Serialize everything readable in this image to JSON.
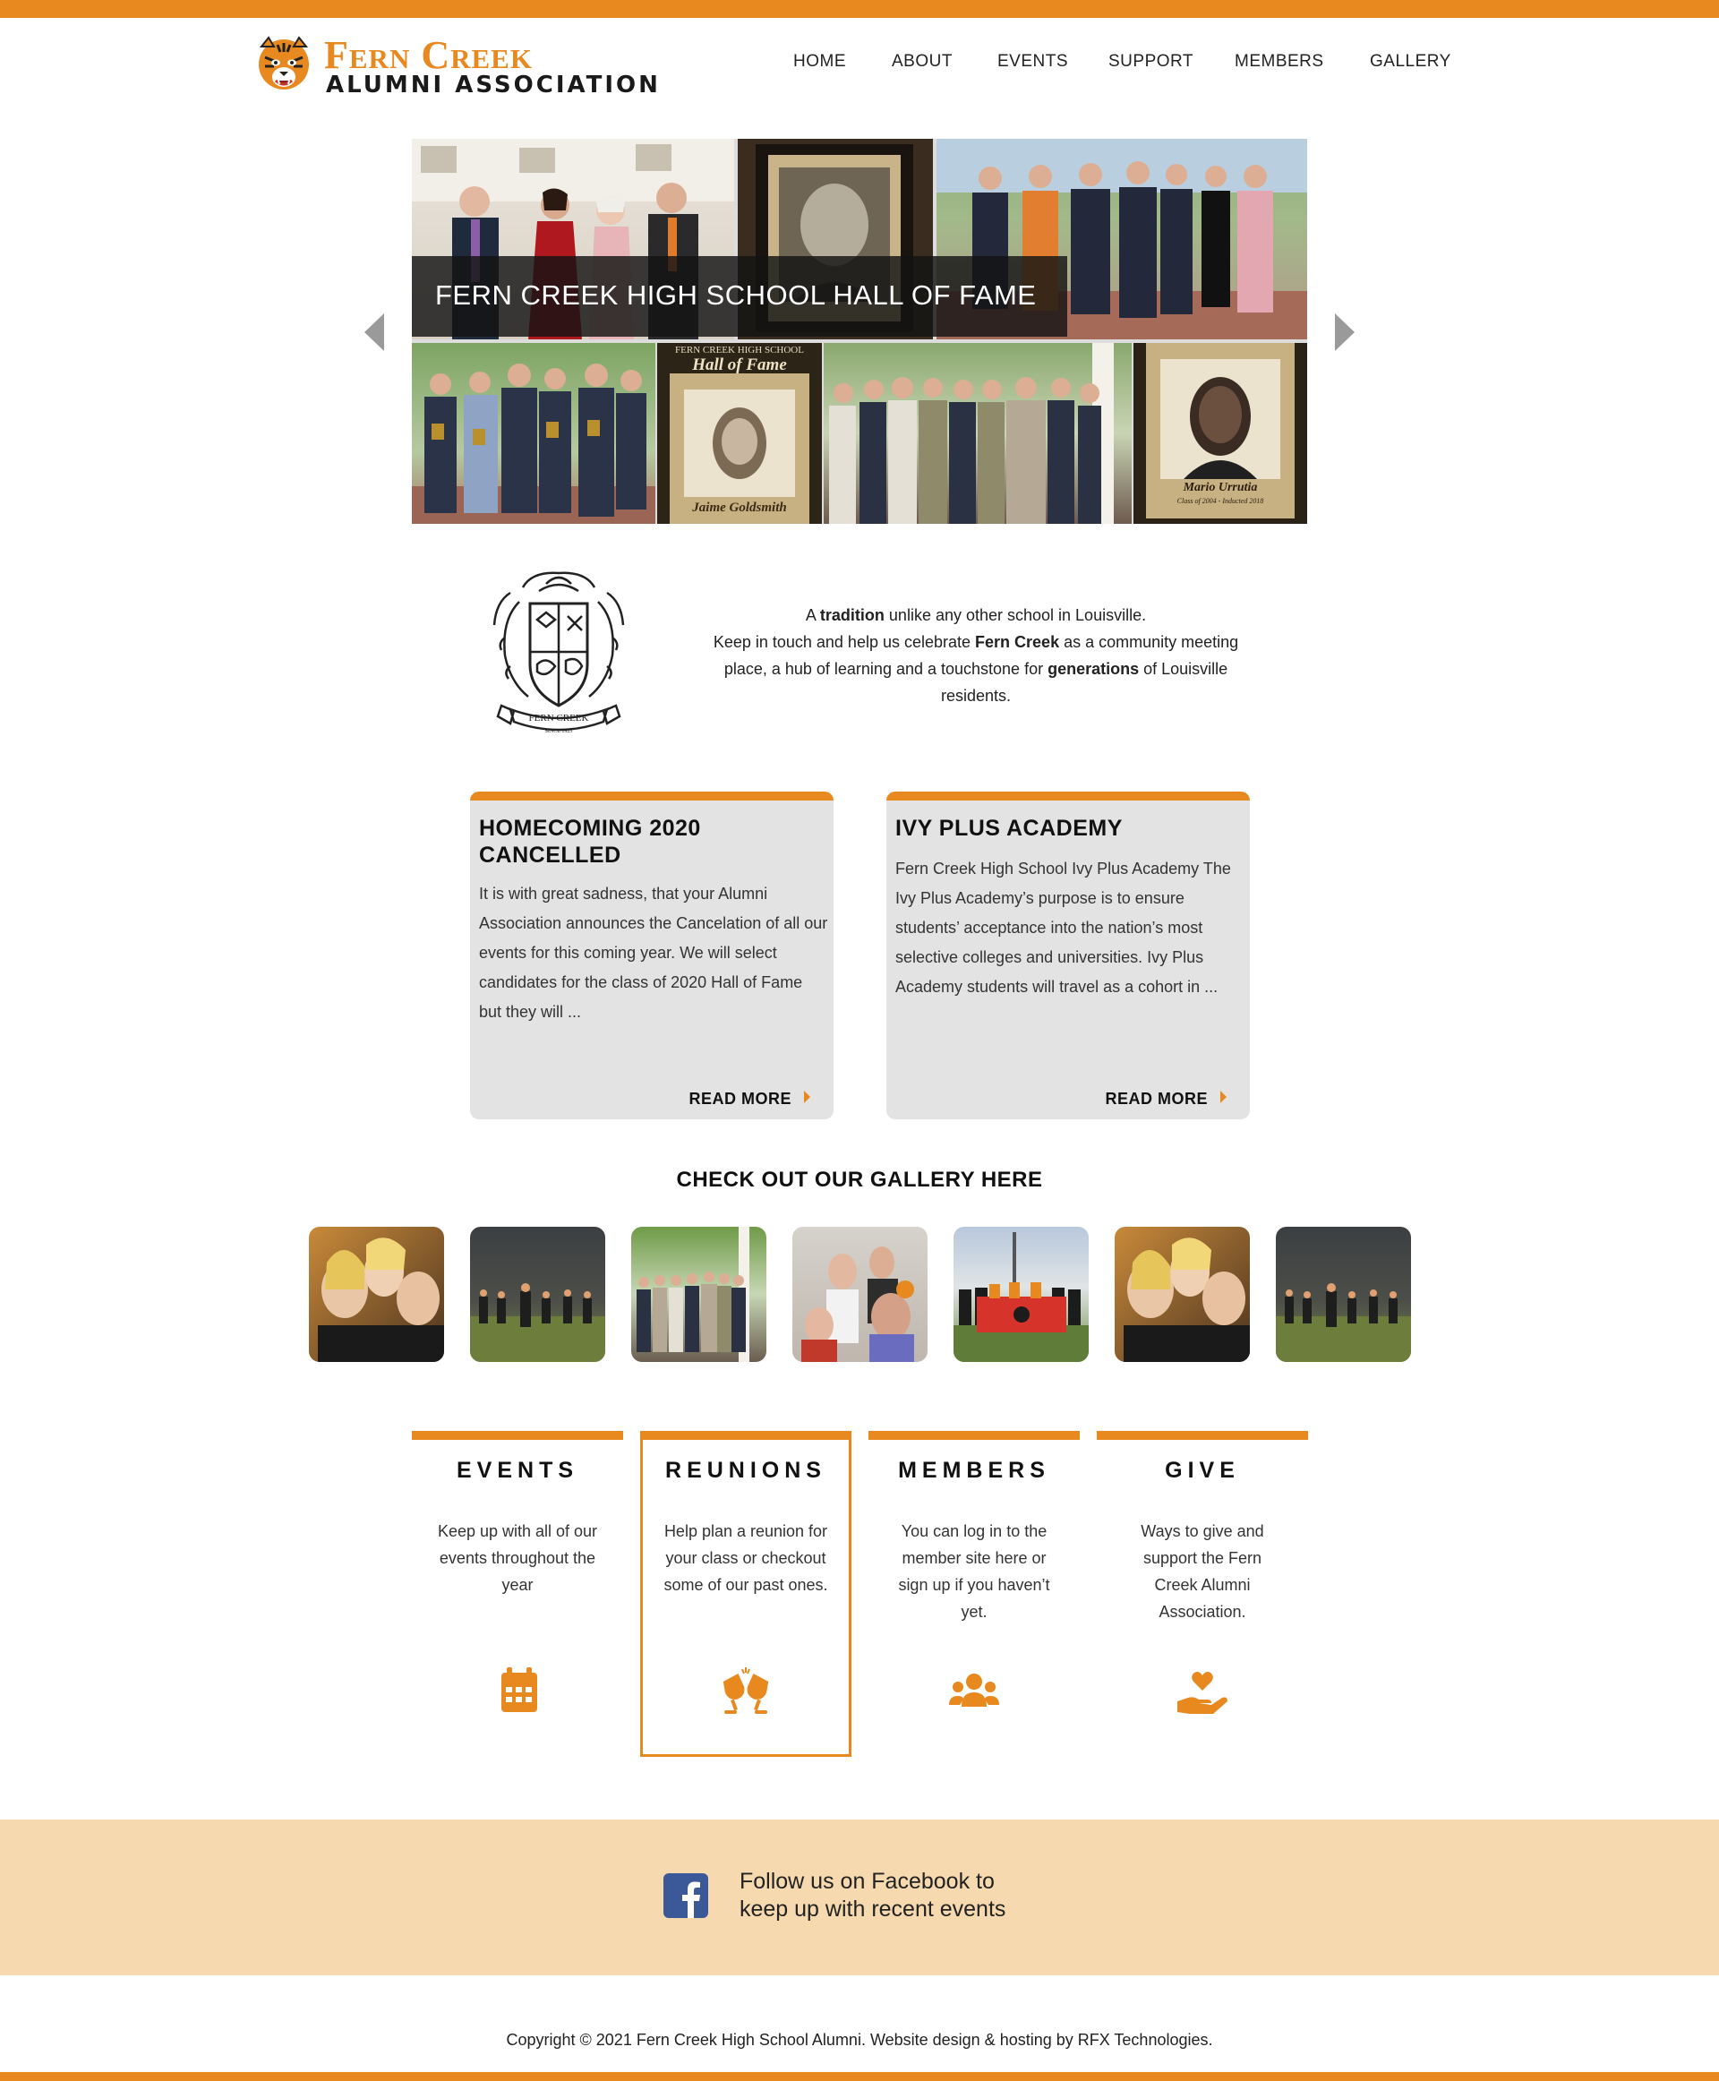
{
  "colors": {
    "accent": "#e8891f",
    "card_bg": "#e3e3e3",
    "band_bg": "#f6d9af",
    "facebook": "#3b5998"
  },
  "header": {
    "logo_line1": "Fern Creek",
    "logo_line2": "ALUMNI ASSOCIATION",
    "logo_icon": "tiger-head-icon",
    "nav": [
      "HOME",
      "ABOUT",
      "EVENTS",
      "SUPPORT",
      "MEMBERS",
      "GALLERY"
    ]
  },
  "slider": {
    "caption": "FERN CREEK HIGH SCHOOL HALL OF FAME",
    "plaque_texts": [
      "FERN CREEK HIGH SCHOOL",
      "Hall of Fame",
      "Jaime Goldsmith",
      "Mario Urrutia",
      "Class of 2004 - Inducted 2018"
    ]
  },
  "intro": {
    "crest_text": "FERN CREEK",
    "crest_since": "SINCE 1923",
    "line1_pre": "A ",
    "line1_bold": "tradition",
    "line1_post": " unlike any other school in Louisville.",
    "line2_pre": "Keep in touch and help us celebrate ",
    "line2_bold": "Fern Creek",
    "line2_post": " as a community meeting place, a hub of learning and a touchstone for ",
    "line3_bold": "generations",
    "line3_post": " of Louisville residents."
  },
  "news": [
    {
      "title": "HOMECOMING 2020 CANCELLED",
      "body": "It is with great sadness, that your Alumni Association announces the Cancelation of all our events for this coming year. We will select candidates for the class of 2020 Hall of Fame but they will ...",
      "link": "READ MORE"
    },
    {
      "title": "IVY PLUS ACADEMY",
      "body": "Fern Creek High School Ivy Plus Academy The Ivy Plus Academy’s purpose is to ensure students’ acceptance into the nation’s most selective colleges and universities. Ivy Plus Academy students will travel as a cohort in ...",
      "link": "READ MORE"
    }
  ],
  "gallery": {
    "title": "CHECK OUT OUR GALLERY HERE"
  },
  "features": [
    {
      "title": "EVENTS",
      "text": "Keep up with all of our events throughout the year",
      "icon": "calendar-icon"
    },
    {
      "title": "REUNIONS",
      "text": "Help plan a reunion for your class or checkout some of our past ones.",
      "icon": "cheers-glasses-icon"
    },
    {
      "title": "MEMBERS",
      "text": "You can log in to the member site here or sign up if you haven’t yet.",
      "icon": "group-users-icon"
    },
    {
      "title": "GIVE",
      "text": "Ways to give and support the Fern Creek Alumni Association.",
      "icon": "heart-hand-icon"
    }
  ],
  "facebook": {
    "text_line1": "Follow us on Facebook to",
    "text_line2": "keep up with recent events",
    "icon": "facebook-icon"
  },
  "footer": {
    "copyright": "Copyright © 2021 Fern Creek High School Alumni. Website design & hosting by  RFX Technologies."
  }
}
